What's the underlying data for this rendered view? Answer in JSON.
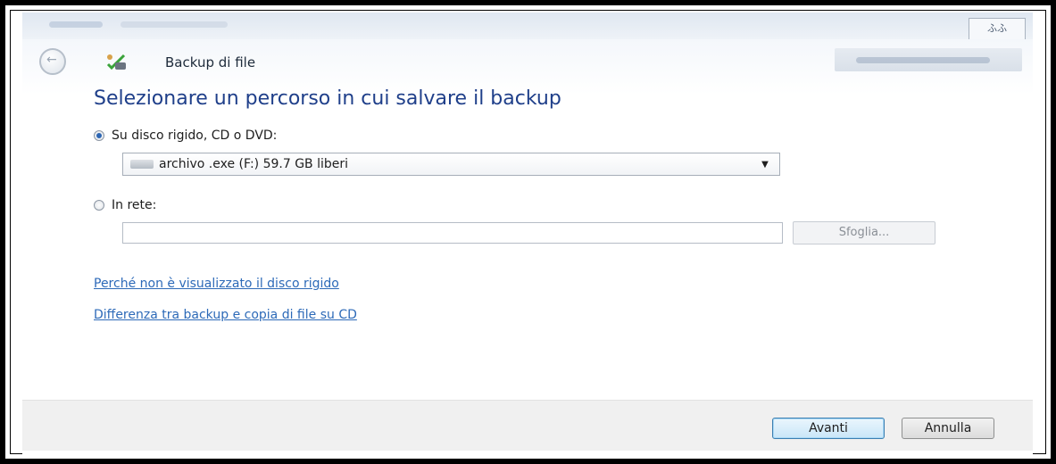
{
  "window": {
    "title": "Backup di file",
    "restore_label": "ふふ"
  },
  "page": {
    "heading": "Selezionare un percorso in cui salvare il backup"
  },
  "options": {
    "local": {
      "label": "Su disco rigido, CD o DVD:",
      "checked": true,
      "selected_drive": "archivo .exe (F:)  59.7 GB liberi"
    },
    "network": {
      "label": "In rete:",
      "checked": false,
      "path_value": "",
      "browse_label": "Sfoglia..."
    }
  },
  "links": [
    "Perché non è visualizzato il disco rigido",
    "Differenza tra backup e copia di file su CD"
  ],
  "footer": {
    "next_label": "Avanti",
    "cancel_label": "Annulla"
  },
  "colors": {
    "heading": "#1f3f8a",
    "link": "#2d6ab8",
    "footer_bg": "#f0f0f0",
    "primary_border": "#3c7fb1"
  },
  "icons": {
    "back": "back-arrow-icon",
    "app": "backup-icon",
    "drive": "drive-icon",
    "dropdown": "chevron-down-icon"
  }
}
